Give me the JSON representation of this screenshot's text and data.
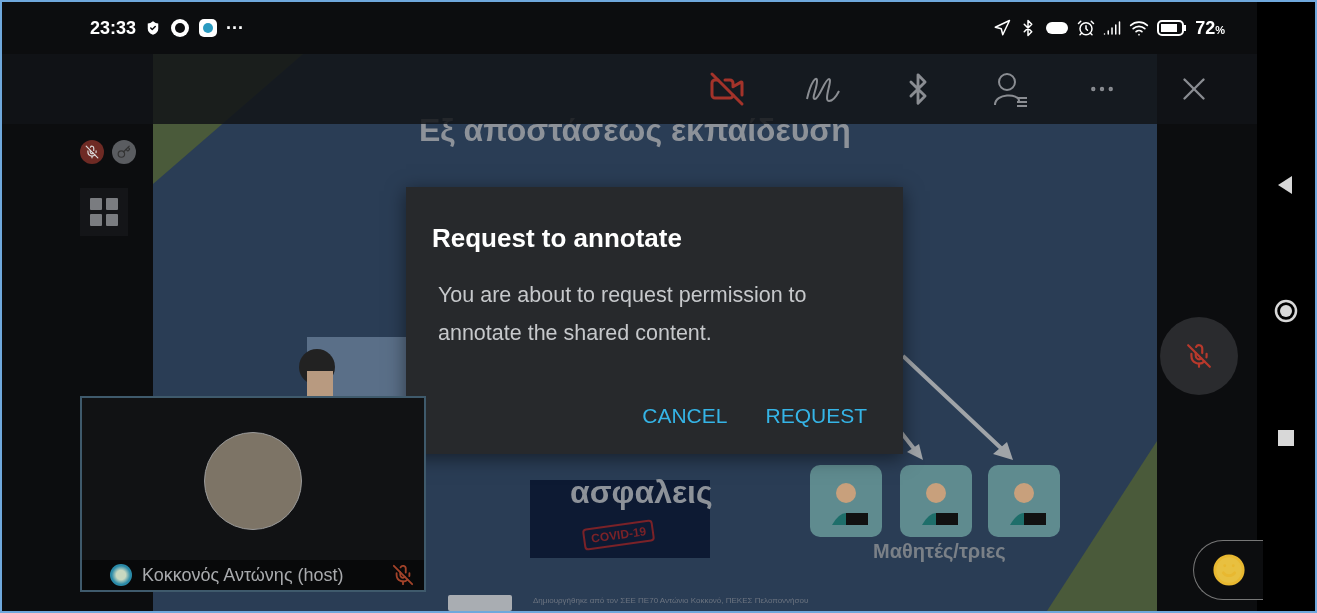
{
  "status_bar": {
    "time": "23:33",
    "more": "···",
    "battery_percent": "72",
    "battery_unit": "%"
  },
  "slide": {
    "title": "Εξ αποστάσεως εκπαίδευση",
    "text": "ασφαλεις",
    "stamp": "COVID-19",
    "students_label": "Μαθητές/τριες",
    "credit": "Δημιουργήθηκε από τον ΣΕΕ ΠΕ70 Αντώνιο Κοκκονό, ΠΕΚΕΣ Πελοποννήσου"
  },
  "dialog": {
    "title": "Request to annotate",
    "message": "You are about to request permission to annotate the shared content.",
    "buttons": [
      "CANCEL",
      "REQUEST"
    ]
  },
  "video_tile": {
    "name": "Κοκκονός Αντώνης (host)"
  }
}
